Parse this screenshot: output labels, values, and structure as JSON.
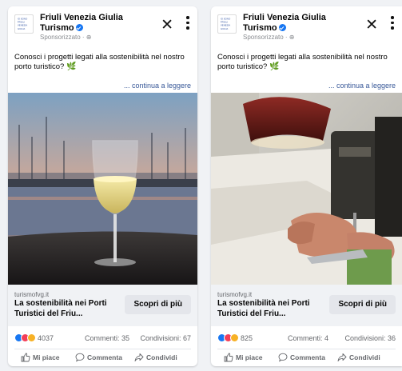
{
  "posts": [
    {
      "page_name": "Friuli Venezia Giulia Turismo",
      "sponsored_label": "Sponsorizzato · ⊕",
      "body": "Conosci i progetti legati alla sostenibilità nel nostro porto turistico?",
      "leaf_glyph": "🌿",
      "read_more": "... continua a leggere",
      "image_icon": "wine-glass-harbor-photo",
      "domain": "turismofvg.it",
      "headline": "La sostenibilità nei Porti Turistici del Friu...",
      "cta_label": "Scopri di più",
      "reaction_count": "4037",
      "comments": "Commenti: 35",
      "shares": "Condivisioni: 67",
      "like_label": "Mi piace",
      "comment_label": "Commenta",
      "share_label": "Condividi"
    },
    {
      "page_name": "Friuli Venezia Giulia Turismo",
      "sponsored_label": "Sponsorizzato · ⊕",
      "body": "Conosci i progetti legati alla sostenibilità nel nostro porto turistico?",
      "leaf_glyph": "🌿",
      "read_more": "... continua a leggere",
      "image_icon": "sewing-machine-sail-photo",
      "domain": "turismofvg.it",
      "headline": "La sostenibilità nei Porti Turistici del Friu...",
      "cta_label": "Scopri di più",
      "reaction_count": "825",
      "comments": "Commenti: 4",
      "shares": "Condivisioni: 36",
      "like_label": "Mi piace",
      "comment_label": "Commenta",
      "share_label": "Condividi"
    }
  ],
  "logo_text": [
    "IO SONO",
    "FRIULI",
    "VENEZIA",
    "GIULIA"
  ],
  "colors": {
    "link_blue": "#385898",
    "verified": "#1877f2",
    "love": "#f33e58",
    "haha": "#f7b125",
    "link_bar_bg": "#f0f2f5"
  }
}
